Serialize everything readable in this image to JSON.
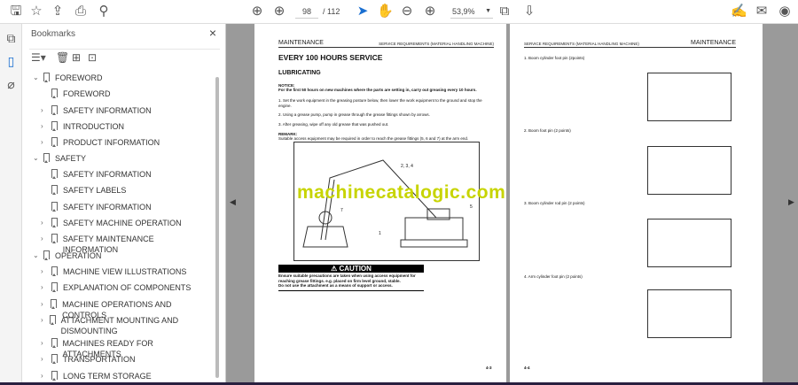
{
  "toolbar": {
    "page_current": "98",
    "page_total": "/ 112",
    "zoom": "53,9%"
  },
  "bookmarks": {
    "title": "Bookmarks",
    "items": [
      {
        "label": "FOREWORD",
        "level": 0,
        "expanded": true
      },
      {
        "label": "FOREWORD",
        "level": 1,
        "leaf": true
      },
      {
        "label": "SAFETY INFORMATION",
        "level": 1
      },
      {
        "label": "INTRODUCTION",
        "level": 1
      },
      {
        "label": "PRODUCT INFORMATION",
        "level": 1
      },
      {
        "label": "SAFETY",
        "level": 0,
        "expanded": true
      },
      {
        "label": "SAFETY INFORMATION",
        "level": 1,
        "leaf": true
      },
      {
        "label": "SAFETY LABELS",
        "level": 1,
        "leaf": true
      },
      {
        "label": "SAFETY INFORMATION",
        "level": 1,
        "leaf": true
      },
      {
        "label": "SAFETY MACHINE OPERATION",
        "level": 1
      },
      {
        "label": "SAFETY MAINTENANCE INFORMATION",
        "level": 1
      },
      {
        "label": "OPERATION",
        "level": 0,
        "expanded": true
      },
      {
        "label": "MACHINE VIEW ILLUSTRATIONS",
        "level": 1
      },
      {
        "label": "EXPLANATION OF COMPONENTS",
        "level": 1
      },
      {
        "label": "MACHINE OPERATIONS AND CONTROLS",
        "level": 1
      },
      {
        "label": "ATTACHMENT MOUNTING AND DISMOUNTING",
        "level": 1
      },
      {
        "label": "MACHINES READY FOR ATTACHMENTS",
        "level": 1
      },
      {
        "label": "TRANSPORTATION",
        "level": 1
      },
      {
        "label": "LONG TERM STORAGE",
        "level": 1
      }
    ]
  },
  "left_page": {
    "header_left": "MAINTENANCE",
    "header_right": "SERVICE REQUIREMENTS (MATERIAL HANDLING MACHINE)",
    "title": "EVERY 100 HOURS SERVICE",
    "subtitle": "LUBRICATING",
    "notice_label": "NOTICE:",
    "notice": "For the first 50 hours on new machines where the parts are setting in, carry out greasing every 10 hours.",
    "steps": [
      "1.   Set the work equipment in the greasing posture below, then lower the work equipment to the ground and stop the engine.",
      "2.   Using a grease pump, pump in grease through the grease fittings shown by arrows.",
      "3.   After greasing, wipe off any old grease that was pushed out."
    ],
    "remark_label": "REMARK:",
    "remark": "Suitable access equipment may be required in order to reach the grease fittings (5, 6 and 7) at the arm end.",
    "fig_labels": {
      "a": "2, 3, 4",
      "b": "7",
      "c": "1",
      "d": "5"
    },
    "caution_title": "CAUTION",
    "caution_text": "Ensure suitable precautions are taken when using access equipment for reaching grease fittings. e.g. placed on firm level ground, stable.\nDo not use the attachment as a means of support or access.",
    "page_no": "4-3"
  },
  "right_page": {
    "header_left": "SERVICE REQUIREMENTS (MATERIAL HANDLING MACHINE)",
    "header_right": "MAINTENANCE",
    "items": [
      "1. Boom cylinder foot pin (2points)",
      "2. Boom foot pin (2 points)",
      "3. Boom cylinder rod pin (2 points)",
      "4. Arm cylinder foot pin (2 points)"
    ],
    "page_no": "4-4"
  },
  "watermark": "machinecatalogic.com"
}
